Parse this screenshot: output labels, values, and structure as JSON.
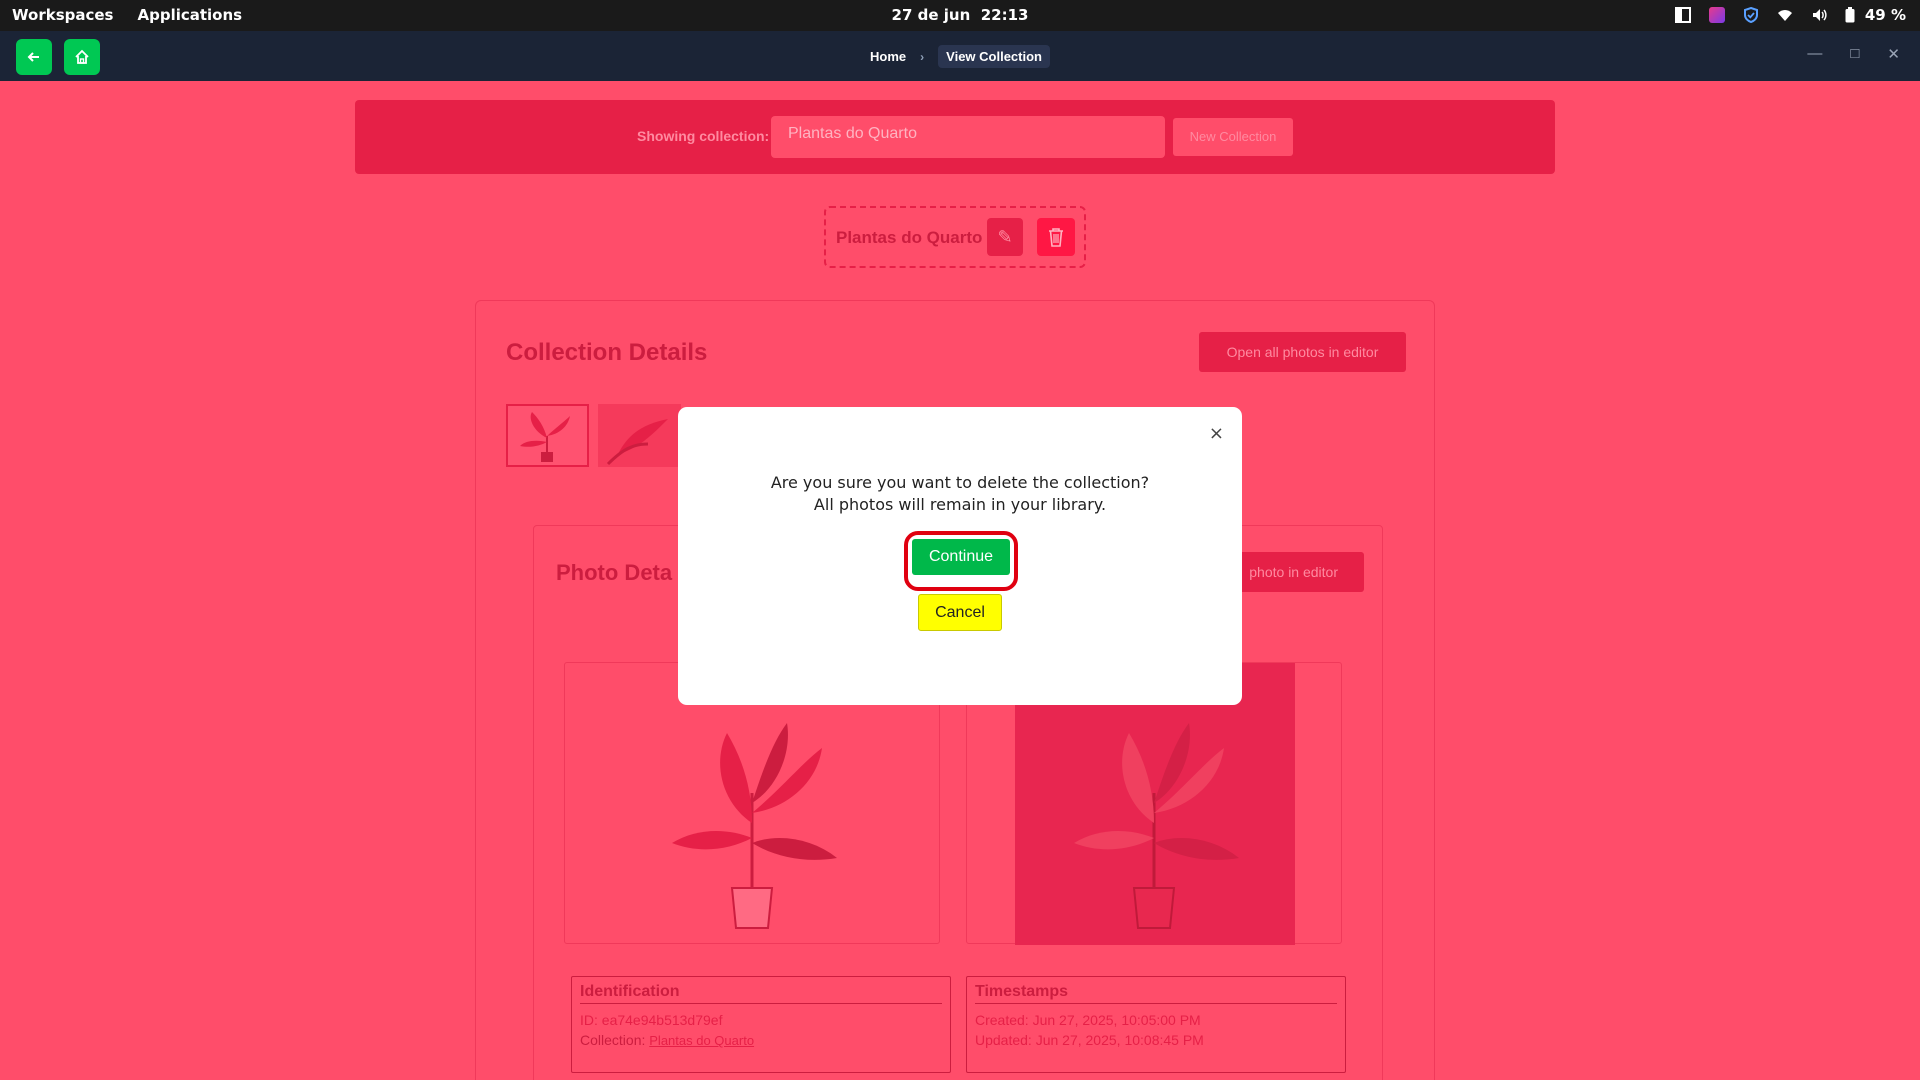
{
  "system_bar": {
    "workspaces": "Workspaces",
    "applications": "Applications",
    "date": "27 de jun",
    "time": "22:13",
    "battery": "49 %",
    "icons": [
      "grid-icon",
      "app-indicator-icon",
      "shield-icon",
      "wifi-icon",
      "volume-icon",
      "battery-icon"
    ]
  },
  "app_header": {
    "back_icon": "arrow-left-icon",
    "home_icon": "home-icon",
    "breadcrumb": [
      "Home",
      "View Collection"
    ],
    "breadcrumb_separator": "›",
    "window_controls": [
      "minimize-icon",
      "maximize-icon",
      "close-icon"
    ]
  },
  "collection_bar": {
    "label": "Showing collection:",
    "selected": "Plantas do Quarto",
    "new_button": "New Collection"
  },
  "collection_header": {
    "name": "Plantas do Quarto",
    "edit_icon": "pencil-icon",
    "delete_icon": "trash-icon"
  },
  "collection_details": {
    "title": "Collection Details",
    "open_all_button": "Open all photos in editor"
  },
  "photo_details": {
    "title": "Photo Deta",
    "open_button": "photo in editor",
    "identification": {
      "title": "Identification",
      "id": "ID: ea74e94b513d79ef",
      "collection_label": "Collection:",
      "collection_link": "Plantas do Quarto"
    },
    "timestamps": {
      "title": "Timestamps",
      "created": "Created: Jun 27, 2025, 10:05:00 PM",
      "updated": "Updated: Jun 27, 2025, 10:08:45 PM"
    }
  },
  "modal": {
    "close": "×",
    "line1": "Are you sure you want to delete the collection?",
    "line2": "All photos will remain in your library.",
    "continue": "Continue",
    "cancel": "Cancel"
  },
  "colors": {
    "page_bg": "#ff4d6a",
    "accent": "#e62047",
    "continue": "#00b84a",
    "cancel": "#ffff00",
    "highlight_ring": "#e00010"
  }
}
